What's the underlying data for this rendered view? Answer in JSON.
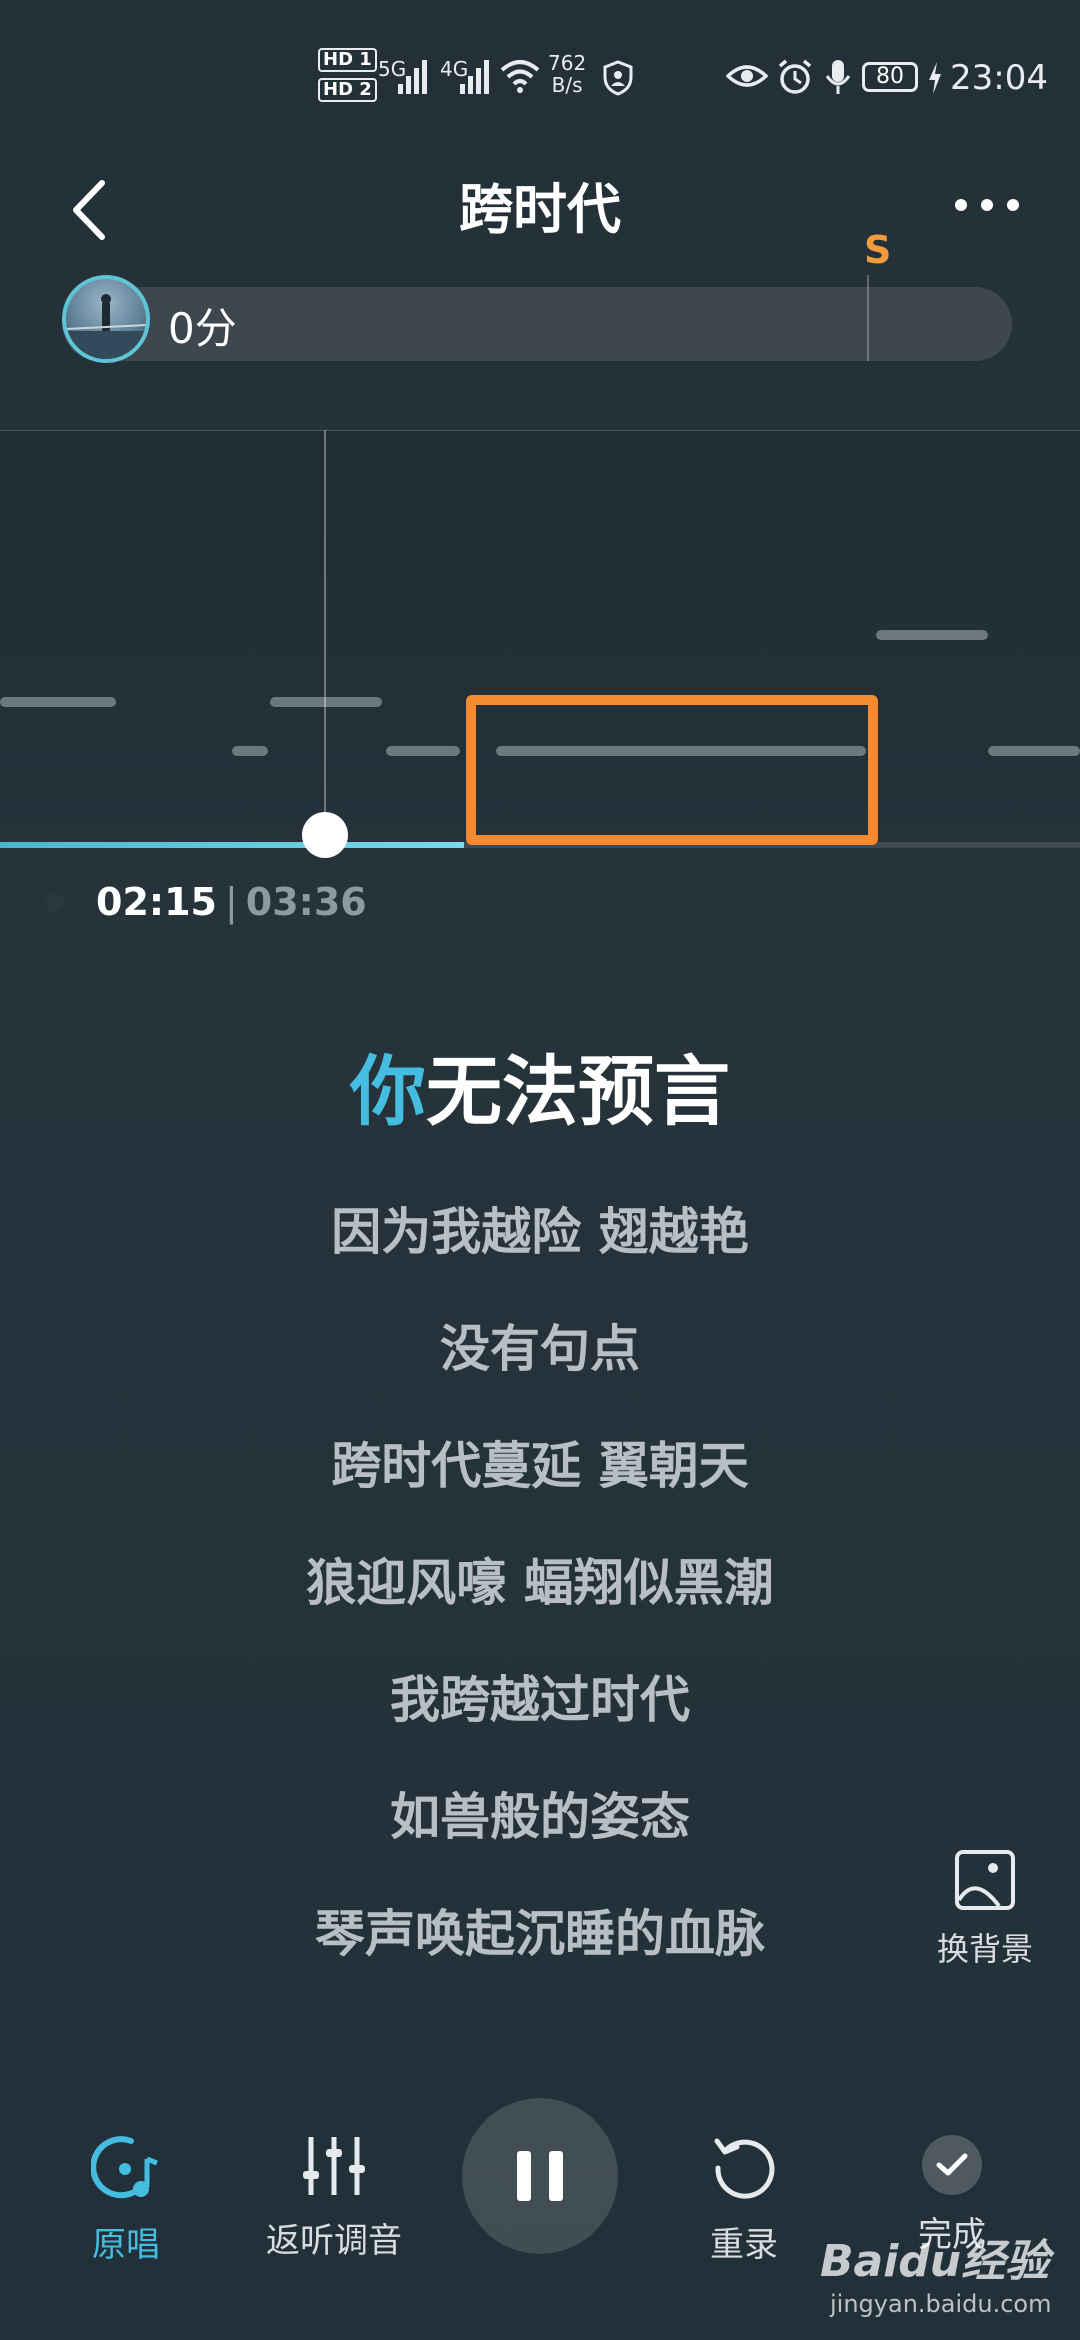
{
  "status_bar": {
    "sim1": "HD 1",
    "sim2": "HD 2",
    "net1": "5G",
    "net2": "4G",
    "speed_value": "762",
    "speed_unit": "B/s",
    "battery": "80",
    "time": "23:04"
  },
  "header": {
    "title": "跨时代"
  },
  "score": {
    "value": "0分",
    "marker": "S"
  },
  "playback": {
    "current": "02:15",
    "separator": "|",
    "total": "03:36",
    "progress": 0.43
  },
  "lyrics": {
    "current_sung": "你",
    "current_rest": "无法预言",
    "upcoming": [
      "因为我越险 翅越艳",
      "没有句点",
      "跨时代蔓延 翼朝天",
      "狼迎风嚎 蝠翔似黑潮",
      "我跨越过时代",
      "如兽般的姿态",
      "琴声唤起沉睡的血脉"
    ]
  },
  "side_actions": {
    "change_background": "换背景"
  },
  "controls": {
    "original": "原唱",
    "monitor_tune": "返听调音",
    "rerecord": "重录",
    "done": "完成"
  },
  "watermark": {
    "brand": "Baidu经验",
    "url": "jingyan.baidu.com"
  },
  "colors": {
    "accent": "#45bde0",
    "highlight": "#f58a30",
    "score_marker": "#f29a3d"
  }
}
